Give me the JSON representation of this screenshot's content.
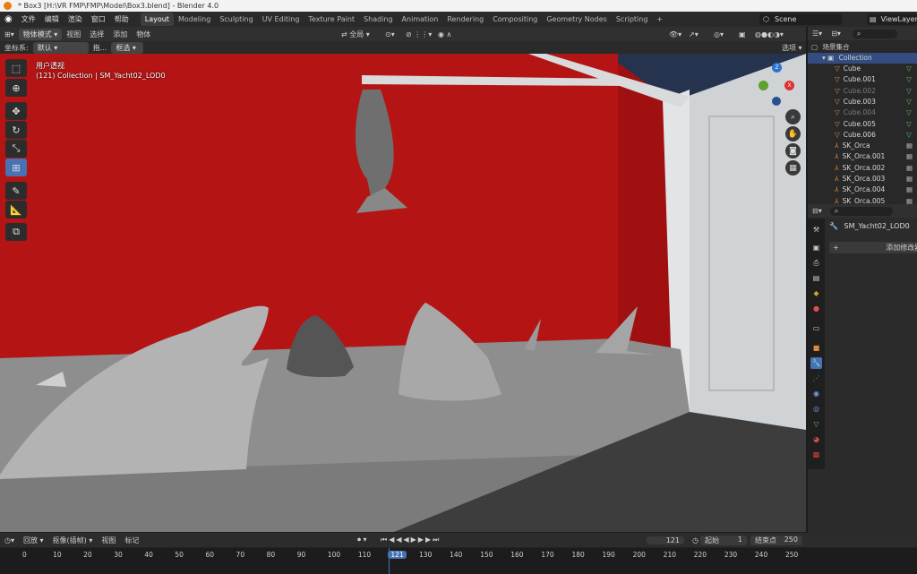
{
  "window": {
    "title": "* Box3 [H:\\VR FMP\\FMP\\Model\\Box3.blend] - Blender 4.0"
  },
  "menu": {
    "items": [
      "文件",
      "编辑",
      "渲染",
      "窗口",
      "帮助"
    ]
  },
  "workspaces": {
    "tabs": [
      "Layout",
      "Modeling",
      "Sculpting",
      "UV Editing",
      "Texture Paint",
      "Shading",
      "Animation",
      "Rendering",
      "Compositing",
      "Geometry Nodes",
      "Scripting"
    ],
    "add": "+",
    "active": "Layout"
  },
  "scene": {
    "name": "Scene",
    "view_layer": "ViewLayer"
  },
  "viewport_header": {
    "mode": "物体模式",
    "view": "视图",
    "select": "选择",
    "add": "添加",
    "object": "物体",
    "transform_orient": "全局",
    "options": "选项"
  },
  "tool_header": {
    "coord_label": "坐标系:",
    "coord_value": "默认",
    "drag_label": "拖...",
    "drag_value": "框选"
  },
  "overlay": {
    "view_name": "用户透视",
    "collection_info": "(121) Collection | SM_Yacht02_LOD0"
  },
  "gizmo": {
    "x": "X",
    "y": "Y",
    "z": "Z"
  },
  "outliner": {
    "root": "场景集合",
    "collection": "Collection",
    "items": [
      {
        "name": "Cube",
        "type": "mesh",
        "dim": false
      },
      {
        "name": "Cube.001",
        "type": "mesh",
        "dim": false
      },
      {
        "name": "Cube.002",
        "type": "mesh",
        "dim": true
      },
      {
        "name": "Cube.003",
        "type": "mesh",
        "dim": false
      },
      {
        "name": "Cube.004",
        "type": "mesh",
        "dim": true
      },
      {
        "name": "Cube.005",
        "type": "mesh",
        "dim": false
      },
      {
        "name": "Cube.006",
        "type": "mesh",
        "dim": false
      },
      {
        "name": "SK_Orca",
        "type": "armature",
        "dim": false
      },
      {
        "name": "SK_Orca.001",
        "type": "armature",
        "dim": false
      },
      {
        "name": "SK_Orca.002",
        "type": "armature",
        "dim": false
      },
      {
        "name": "SK_Orca.003",
        "type": "armature",
        "dim": false
      },
      {
        "name": "SK_Orca.004",
        "type": "armature",
        "dim": false
      },
      {
        "name": "SK_Orca.005",
        "type": "armature",
        "dim": false
      }
    ]
  },
  "properties": {
    "object_name": "SM_Yacht02_LOD0",
    "add_modifier": "添加修改器"
  },
  "timeline": {
    "playback": "回放",
    "keying": "抠像(插帧)",
    "view": "视图",
    "marker": "标记",
    "current_frame": "121",
    "start_label": "起始",
    "start": "1",
    "end_label": "结束点",
    "end": "250",
    "ruler": [
      "0",
      "10",
      "20",
      "30",
      "40",
      "50",
      "60",
      "70",
      "80",
      "90",
      "100",
      "110",
      "121",
      "130",
      "140",
      "150",
      "160",
      "170",
      "180",
      "190",
      "200",
      "210",
      "220",
      "230",
      "240",
      "250"
    ]
  },
  "colors": {
    "accent": "#4772b3",
    "header": "#303030",
    "panel": "#282828",
    "wall_red": "#b51414",
    "selection": "#334d80"
  }
}
